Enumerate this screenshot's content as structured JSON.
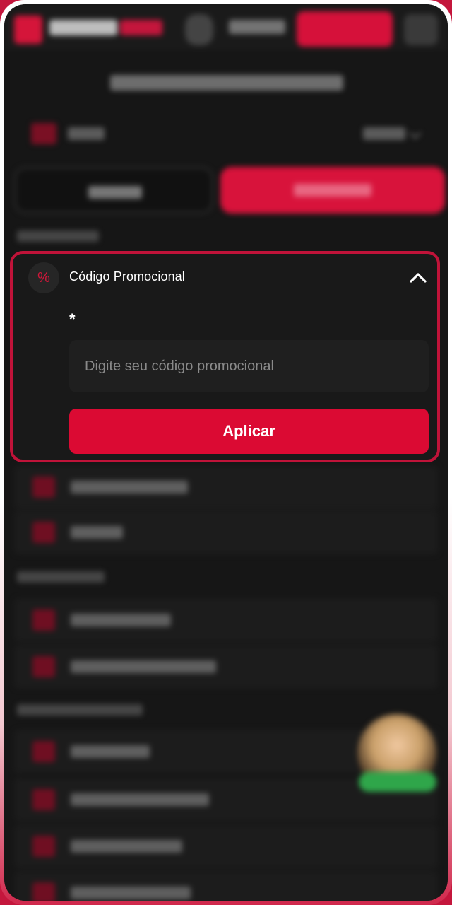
{
  "promo": {
    "badge_symbol": "%",
    "title": "Código Promocional",
    "required_marker": "*",
    "input_placeholder": "Digite seu código promocional",
    "input_value": "",
    "apply_label": "Aplicar"
  },
  "colors": {
    "accent": "#db0a33",
    "card_border": "#c01339",
    "background": "#161616",
    "frame": "#c4163c"
  },
  "icons": {
    "badge": "percent-icon",
    "collapse": "chevron-up-icon"
  }
}
